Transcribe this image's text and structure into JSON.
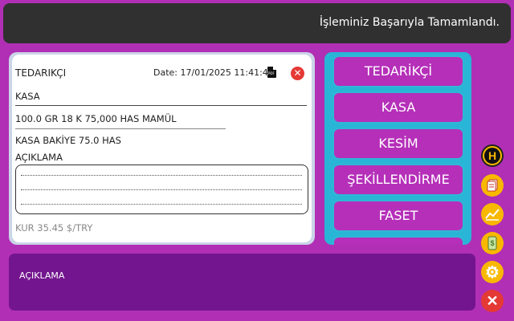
{
  "toast": {
    "message": "İşleminiz Başarıyla Tamamlandı."
  },
  "receipt": {
    "title": "TEDARIKÇI",
    "date": "Date: 17/01/2025 11:41:47",
    "pdf_icon": "pdf-icon",
    "pdf_label": "PDF",
    "close_glyph": "✕",
    "kasa": "KASA",
    "item_line": "100.0 GR 18 K 75,000 HAS  MAMÜL",
    "balance": "KASA BAKİYE  75.0 HAS",
    "note_label": "AÇIKLAMA",
    "exchange_rate": "KUR  35.45 $/TRY"
  },
  "menu": {
    "items": [
      {
        "label": "TEDARİKÇİ"
      },
      {
        "label": "KASA"
      },
      {
        "label": "KESİM"
      },
      {
        "label": "ŞEKİLLENDİRME"
      },
      {
        "label": "FASET"
      },
      {
        "label": ""
      }
    ]
  },
  "note_panel": {
    "label": "AÇIKLAMA"
  },
  "side_icons": {
    "h_letter": "H",
    "gear_glyph": "⚙",
    "close_glyph": "✕"
  },
  "colors": {
    "background": "#b12fb4",
    "menu_border": "#29b5d5",
    "note_panel": "#73158e",
    "icon_accent": "#f8b800",
    "close_red": "#e53935"
  }
}
